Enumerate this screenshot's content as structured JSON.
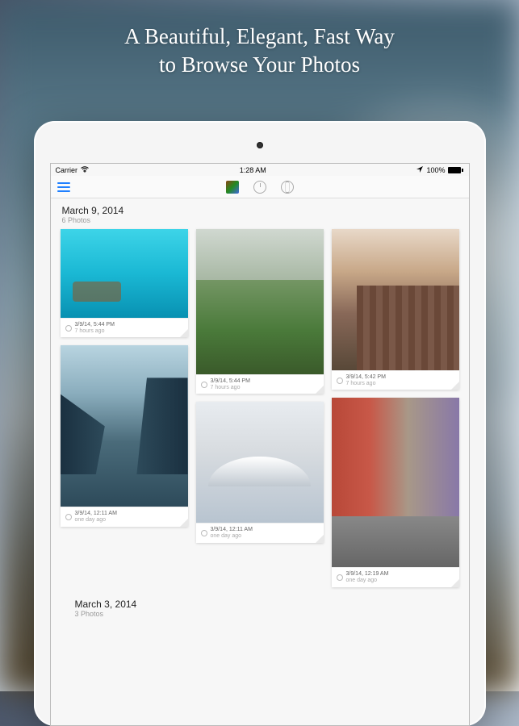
{
  "headline": {
    "line1": "A Beautiful, Elegant, Fast Way",
    "line2": "to Browse Your Photos"
  },
  "statusbar": {
    "carrier": "Carrier",
    "time": "1:28 AM",
    "battery": "100%"
  },
  "sections": [
    {
      "date": "March 9, 2014",
      "count": "6 Photos",
      "photos": [
        {
          "ts": "3/9/14, 5:44 PM",
          "ago": "7 hours ago"
        },
        {
          "ts": "3/9/14, 12:11 AM",
          "ago": "one day ago"
        },
        {
          "ts": "3/9/14, 5:44 PM",
          "ago": "7 hours ago"
        },
        {
          "ts": "3/9/14, 12:11 AM",
          "ago": "one day ago"
        },
        {
          "ts": "3/9/14, 5:42 PM",
          "ago": "7 hours ago"
        },
        {
          "ts": "3/9/14, 12:19 AM",
          "ago": "one day ago"
        }
      ]
    },
    {
      "date": "March 3, 2014",
      "count": "3 Photos"
    }
  ]
}
